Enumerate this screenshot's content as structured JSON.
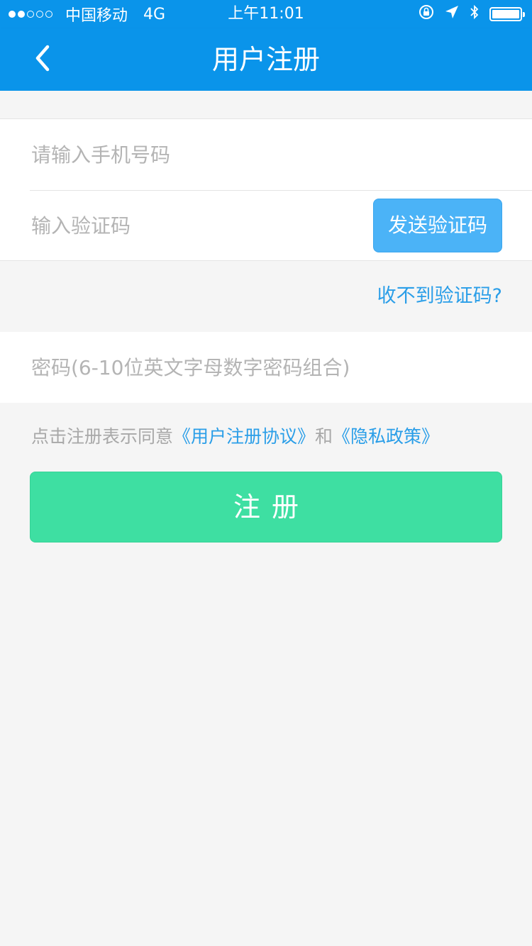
{
  "status_bar": {
    "carrier": "中国移动",
    "network": "4G",
    "time": "上午11:01",
    "signal_strength": 2,
    "signal_total": 5,
    "battery_level": 1.0
  },
  "nav": {
    "title": "用户注册",
    "back_icon": "chevron-left-icon"
  },
  "form": {
    "phone_placeholder": "请输入手机号码",
    "code_placeholder": "输入验证码",
    "send_code_label": "发送验证码",
    "no_code_link": "收不到验证码?",
    "password_placeholder": "密码(6-10位英文字母数字密码组合)"
  },
  "agreement": {
    "prefix": "点击注册表示同意",
    "user_agreement": "《用户注册协议》",
    "conjunction": "和",
    "privacy_policy": "《隐私政策》"
  },
  "register_button_label": "注册",
  "colors": {
    "primary": "#0a94ea",
    "send_button": "#4bb3f7",
    "link": "#2a9ee8",
    "register_button": "#3edfa2",
    "background": "#f5f5f5"
  }
}
